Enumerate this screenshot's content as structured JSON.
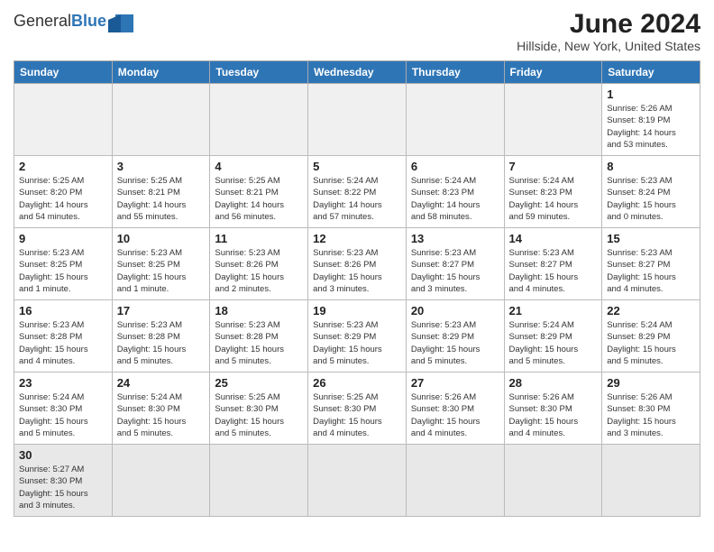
{
  "header": {
    "logo_general": "General",
    "logo_blue": "Blue",
    "title": "June 2024",
    "subtitle": "Hillside, New York, United States"
  },
  "weekdays": [
    "Sunday",
    "Monday",
    "Tuesday",
    "Wednesday",
    "Thursday",
    "Friday",
    "Saturday"
  ],
  "weeks": [
    [
      {
        "day": "",
        "info": ""
      },
      {
        "day": "",
        "info": ""
      },
      {
        "day": "",
        "info": ""
      },
      {
        "day": "",
        "info": ""
      },
      {
        "day": "",
        "info": ""
      },
      {
        "day": "",
        "info": ""
      },
      {
        "day": "1",
        "info": "Sunrise: 5:26 AM\nSunset: 8:19 PM\nDaylight: 14 hours\nand 53 minutes."
      }
    ],
    [
      {
        "day": "2",
        "info": "Sunrise: 5:25 AM\nSunset: 8:20 PM\nDaylight: 14 hours\nand 54 minutes."
      },
      {
        "day": "3",
        "info": "Sunrise: 5:25 AM\nSunset: 8:21 PM\nDaylight: 14 hours\nand 55 minutes."
      },
      {
        "day": "4",
        "info": "Sunrise: 5:25 AM\nSunset: 8:21 PM\nDaylight: 14 hours\nand 56 minutes."
      },
      {
        "day": "5",
        "info": "Sunrise: 5:24 AM\nSunset: 8:22 PM\nDaylight: 14 hours\nand 57 minutes."
      },
      {
        "day": "6",
        "info": "Sunrise: 5:24 AM\nSunset: 8:23 PM\nDaylight: 14 hours\nand 58 minutes."
      },
      {
        "day": "7",
        "info": "Sunrise: 5:24 AM\nSunset: 8:23 PM\nDaylight: 14 hours\nand 59 minutes."
      },
      {
        "day": "8",
        "info": "Sunrise: 5:23 AM\nSunset: 8:24 PM\nDaylight: 15 hours\nand 0 minutes."
      }
    ],
    [
      {
        "day": "9",
        "info": "Sunrise: 5:23 AM\nSunset: 8:25 PM\nDaylight: 15 hours\nand 1 minute."
      },
      {
        "day": "10",
        "info": "Sunrise: 5:23 AM\nSunset: 8:25 PM\nDaylight: 15 hours\nand 1 minute."
      },
      {
        "day": "11",
        "info": "Sunrise: 5:23 AM\nSunset: 8:26 PM\nDaylight: 15 hours\nand 2 minutes."
      },
      {
        "day": "12",
        "info": "Sunrise: 5:23 AM\nSunset: 8:26 PM\nDaylight: 15 hours\nand 3 minutes."
      },
      {
        "day": "13",
        "info": "Sunrise: 5:23 AM\nSunset: 8:27 PM\nDaylight: 15 hours\nand 3 minutes."
      },
      {
        "day": "14",
        "info": "Sunrise: 5:23 AM\nSunset: 8:27 PM\nDaylight: 15 hours\nand 4 minutes."
      },
      {
        "day": "15",
        "info": "Sunrise: 5:23 AM\nSunset: 8:27 PM\nDaylight: 15 hours\nand 4 minutes."
      }
    ],
    [
      {
        "day": "16",
        "info": "Sunrise: 5:23 AM\nSunset: 8:28 PM\nDaylight: 15 hours\nand 4 minutes."
      },
      {
        "day": "17",
        "info": "Sunrise: 5:23 AM\nSunset: 8:28 PM\nDaylight: 15 hours\nand 5 minutes."
      },
      {
        "day": "18",
        "info": "Sunrise: 5:23 AM\nSunset: 8:28 PM\nDaylight: 15 hours\nand 5 minutes."
      },
      {
        "day": "19",
        "info": "Sunrise: 5:23 AM\nSunset: 8:29 PM\nDaylight: 15 hours\nand 5 minutes."
      },
      {
        "day": "20",
        "info": "Sunrise: 5:23 AM\nSunset: 8:29 PM\nDaylight: 15 hours\nand 5 minutes."
      },
      {
        "day": "21",
        "info": "Sunrise: 5:24 AM\nSunset: 8:29 PM\nDaylight: 15 hours\nand 5 minutes."
      },
      {
        "day": "22",
        "info": "Sunrise: 5:24 AM\nSunset: 8:29 PM\nDaylight: 15 hours\nand 5 minutes."
      }
    ],
    [
      {
        "day": "23",
        "info": "Sunrise: 5:24 AM\nSunset: 8:30 PM\nDaylight: 15 hours\nand 5 minutes."
      },
      {
        "day": "24",
        "info": "Sunrise: 5:24 AM\nSunset: 8:30 PM\nDaylight: 15 hours\nand 5 minutes."
      },
      {
        "day": "25",
        "info": "Sunrise: 5:25 AM\nSunset: 8:30 PM\nDaylight: 15 hours\nand 5 minutes."
      },
      {
        "day": "26",
        "info": "Sunrise: 5:25 AM\nSunset: 8:30 PM\nDaylight: 15 hours\nand 4 minutes."
      },
      {
        "day": "27",
        "info": "Sunrise: 5:26 AM\nSunset: 8:30 PM\nDaylight: 15 hours\nand 4 minutes."
      },
      {
        "day": "28",
        "info": "Sunrise: 5:26 AM\nSunset: 8:30 PM\nDaylight: 15 hours\nand 4 minutes."
      },
      {
        "day": "29",
        "info": "Sunrise: 5:26 AM\nSunset: 8:30 PM\nDaylight: 15 hours\nand 3 minutes."
      }
    ],
    [
      {
        "day": "30",
        "info": "Sunrise: 5:27 AM\nSunset: 8:30 PM\nDaylight: 15 hours\nand 3 minutes."
      },
      {
        "day": "",
        "info": ""
      },
      {
        "day": "",
        "info": ""
      },
      {
        "day": "",
        "info": ""
      },
      {
        "day": "",
        "info": ""
      },
      {
        "day": "",
        "info": ""
      },
      {
        "day": "",
        "info": ""
      }
    ]
  ]
}
